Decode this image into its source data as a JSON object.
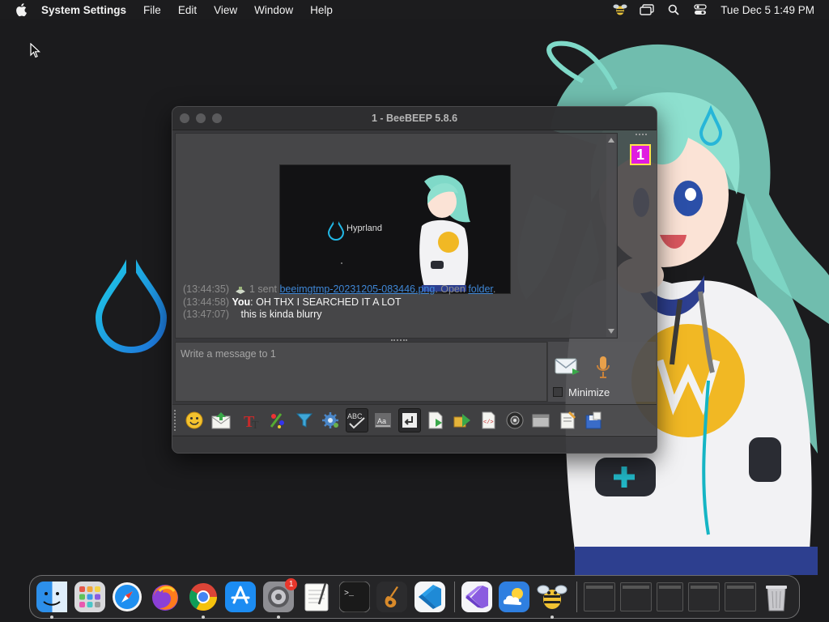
{
  "menubar": {
    "app_name": "System Settings",
    "items": [
      "File",
      "Edit",
      "View",
      "Window",
      "Help"
    ],
    "clock": "Tue Dec 5  1:49 PM",
    "status_icons": [
      "beebeep-icon",
      "window-stack-icon",
      "spotlight-search-icon",
      "control-center-icon"
    ]
  },
  "window": {
    "title": "1 - BeeBEEP 5.8.6",
    "preview": {
      "label": "Hyprland"
    },
    "messages": [
      {
        "time": "(13:44:35)",
        "prefix": " 1 sent ",
        "file_link": "beeimgtmp-20231205-083446.png",
        "mid": ". Open ",
        "folder_link": "folder",
        "end": "."
      },
      {
        "time": "(13:44:58)",
        "sender": "You",
        "text": ": OH THX I SEARCHED IT A LOT"
      },
      {
        "time": "(13:47:07)",
        "text": "this is kinda blurry"
      }
    ],
    "user_badge": "1",
    "input_placeholder": "Write a message to 1",
    "minimize_label": "Minimize",
    "toolbar_icons": [
      "emoticon-icon",
      "send-file-icon",
      "font-icon",
      "color-icon",
      "filter-icon",
      "settings-icon",
      "spellcheck-icon",
      "completer-icon",
      "return-key-icon",
      "save-chat-icon",
      "share-icon",
      "code-icon",
      "screenshot-icon",
      "clear-icon",
      "notes-icon",
      "save-icon"
    ]
  },
  "dock": {
    "apps": [
      {
        "name": "finder",
        "label": "Finder"
      },
      {
        "name": "launchpad",
        "label": "Launchpad"
      },
      {
        "name": "safari",
        "label": "Safari"
      },
      {
        "name": "firefox",
        "label": "Firefox"
      },
      {
        "name": "chrome",
        "label": "Chrome"
      },
      {
        "name": "app-store",
        "label": "App Store"
      },
      {
        "name": "system-settings",
        "label": "System Settings",
        "badge": "1"
      },
      {
        "name": "textedit",
        "label": "TextEdit"
      },
      {
        "name": "terminal",
        "label": "Terminal"
      },
      {
        "name": "garageband",
        "label": "GarageBand"
      },
      {
        "name": "vscode",
        "label": "Visual Studio Code"
      },
      {
        "name": "visual-studio",
        "label": "Visual Studio"
      },
      {
        "name": "weather",
        "label": "Weather"
      },
      {
        "name": "beebeep",
        "label": "BeeBEEP"
      }
    ]
  },
  "colors": {
    "accent_link": "#3f87d6",
    "badge_bg": "#e01ce0",
    "badge_border": "#ffe34a",
    "hyprland_cyan": "#22b8e6"
  }
}
